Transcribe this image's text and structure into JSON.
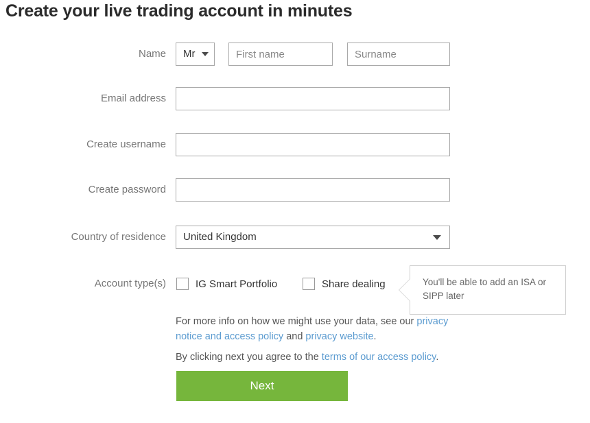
{
  "page": {
    "title": "Create your live trading account in minutes"
  },
  "form": {
    "name_row": {
      "label": "Name",
      "title_select": {
        "value": "Mr",
        "caret_icon": "chevron-down-icon"
      },
      "first_name": {
        "value": "",
        "placeholder": "First name"
      },
      "surname": {
        "value": "",
        "placeholder": "Surname"
      }
    },
    "email_row": {
      "label": "Email address",
      "value": "",
      "placeholder": ""
    },
    "username_row": {
      "label": "Create username",
      "value": "",
      "placeholder": ""
    },
    "password_row": {
      "label": "Create password",
      "value": "",
      "placeholder": ""
    },
    "country_row": {
      "label": "Country of residence",
      "value": "United Kingdom",
      "caret_icon": "chevron-down-icon"
    },
    "account_type_row": {
      "label": "Account type(s)",
      "options": [
        {
          "label": "IG Smart Portfolio",
          "checked": false
        },
        {
          "label": "Share dealing",
          "checked": false
        }
      ]
    }
  },
  "tooltip": {
    "text": "You'll be able to add an ISA or SIPP later"
  },
  "legal": {
    "line1_part1": "For more info on how we might use your data, see our ",
    "link1": "privacy notice and access policy",
    "line1_part2": " and ",
    "link2": "privacy website",
    "line1_part3": ".",
    "line2_part1": "By clicking next you agree to the ",
    "link3": "terms of our access policy",
    "line2_part2": "."
  },
  "actions": {
    "next_label": "Next"
  },
  "colors": {
    "accent_green": "#76b63c",
    "link_blue": "#5b9bd0",
    "label_gray": "#767676",
    "border_gray": "#a9a9a9"
  }
}
